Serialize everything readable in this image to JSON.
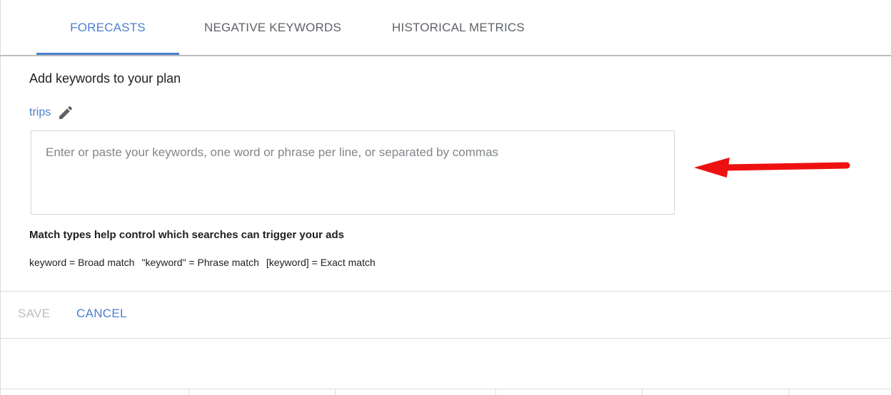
{
  "tabs": [
    {
      "label": "FORECASTS",
      "active": true
    },
    {
      "label": "NEGATIVE KEYWORDS",
      "active": false
    },
    {
      "label": "HISTORICAL METRICS",
      "active": false
    }
  ],
  "main": {
    "title": "Add keywords to your plan",
    "plan_name": "trips",
    "keywords_input": {
      "value": "",
      "placeholder": "Enter or paste your keywords, one word or phrase per line, or separated by commas"
    },
    "match_types_title": "Match types help control which searches can trigger your ads",
    "match_types": [
      "keyword = Broad match",
      "\"keyword\" = Phrase match",
      "[keyword] = Exact match"
    ]
  },
  "actions": {
    "save_label": "SAVE",
    "cancel_label": "CANCEL"
  },
  "colors": {
    "accent": "#4a7fd0",
    "annotation_arrow": "#ee1111",
    "disabled": "#bdbdbd"
  },
  "icons": {
    "edit": "pencil-icon",
    "annotation": "arrow-left-annotation"
  }
}
